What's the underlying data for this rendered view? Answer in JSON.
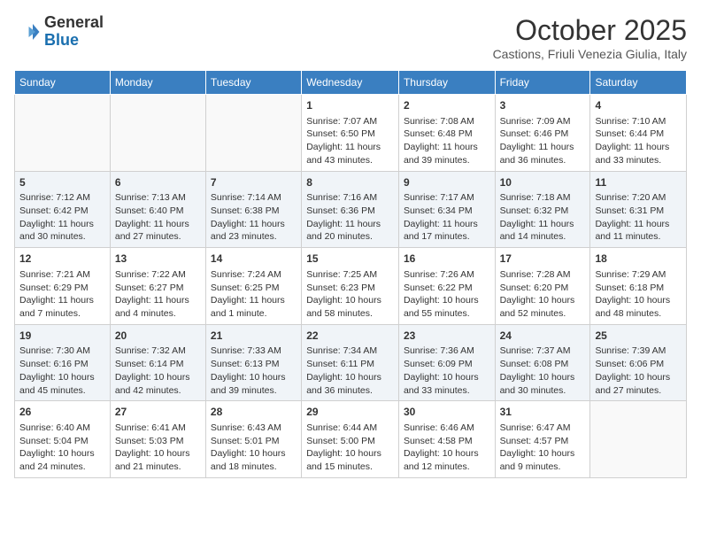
{
  "header": {
    "logo_general": "General",
    "logo_blue": "Blue",
    "month_title": "October 2025",
    "location": "Castions, Friuli Venezia Giulia, Italy"
  },
  "weekdays": [
    "Sunday",
    "Monday",
    "Tuesday",
    "Wednesday",
    "Thursday",
    "Friday",
    "Saturday"
  ],
  "weeks": [
    [
      {
        "day": "",
        "sunrise": "",
        "sunset": "",
        "daylight": ""
      },
      {
        "day": "",
        "sunrise": "",
        "sunset": "",
        "daylight": ""
      },
      {
        "day": "",
        "sunrise": "",
        "sunset": "",
        "daylight": ""
      },
      {
        "day": "1",
        "sunrise": "Sunrise: 7:07 AM",
        "sunset": "Sunset: 6:50 PM",
        "daylight": "Daylight: 11 hours and 43 minutes."
      },
      {
        "day": "2",
        "sunrise": "Sunrise: 7:08 AM",
        "sunset": "Sunset: 6:48 PM",
        "daylight": "Daylight: 11 hours and 39 minutes."
      },
      {
        "day": "3",
        "sunrise": "Sunrise: 7:09 AM",
        "sunset": "Sunset: 6:46 PM",
        "daylight": "Daylight: 11 hours and 36 minutes."
      },
      {
        "day": "4",
        "sunrise": "Sunrise: 7:10 AM",
        "sunset": "Sunset: 6:44 PM",
        "daylight": "Daylight: 11 hours and 33 minutes."
      }
    ],
    [
      {
        "day": "5",
        "sunrise": "Sunrise: 7:12 AM",
        "sunset": "Sunset: 6:42 PM",
        "daylight": "Daylight: 11 hours and 30 minutes."
      },
      {
        "day": "6",
        "sunrise": "Sunrise: 7:13 AM",
        "sunset": "Sunset: 6:40 PM",
        "daylight": "Daylight: 11 hours and 27 minutes."
      },
      {
        "day": "7",
        "sunrise": "Sunrise: 7:14 AM",
        "sunset": "Sunset: 6:38 PM",
        "daylight": "Daylight: 11 hours and 23 minutes."
      },
      {
        "day": "8",
        "sunrise": "Sunrise: 7:16 AM",
        "sunset": "Sunset: 6:36 PM",
        "daylight": "Daylight: 11 hours and 20 minutes."
      },
      {
        "day": "9",
        "sunrise": "Sunrise: 7:17 AM",
        "sunset": "Sunset: 6:34 PM",
        "daylight": "Daylight: 11 hours and 17 minutes."
      },
      {
        "day": "10",
        "sunrise": "Sunrise: 7:18 AM",
        "sunset": "Sunset: 6:32 PM",
        "daylight": "Daylight: 11 hours and 14 minutes."
      },
      {
        "day": "11",
        "sunrise": "Sunrise: 7:20 AM",
        "sunset": "Sunset: 6:31 PM",
        "daylight": "Daylight: 11 hours and 11 minutes."
      }
    ],
    [
      {
        "day": "12",
        "sunrise": "Sunrise: 7:21 AM",
        "sunset": "Sunset: 6:29 PM",
        "daylight": "Daylight: 11 hours and 7 minutes."
      },
      {
        "day": "13",
        "sunrise": "Sunrise: 7:22 AM",
        "sunset": "Sunset: 6:27 PM",
        "daylight": "Daylight: 11 hours and 4 minutes."
      },
      {
        "day": "14",
        "sunrise": "Sunrise: 7:24 AM",
        "sunset": "Sunset: 6:25 PM",
        "daylight": "Daylight: 11 hours and 1 minute."
      },
      {
        "day": "15",
        "sunrise": "Sunrise: 7:25 AM",
        "sunset": "Sunset: 6:23 PM",
        "daylight": "Daylight: 10 hours and 58 minutes."
      },
      {
        "day": "16",
        "sunrise": "Sunrise: 7:26 AM",
        "sunset": "Sunset: 6:22 PM",
        "daylight": "Daylight: 10 hours and 55 minutes."
      },
      {
        "day": "17",
        "sunrise": "Sunrise: 7:28 AM",
        "sunset": "Sunset: 6:20 PM",
        "daylight": "Daylight: 10 hours and 52 minutes."
      },
      {
        "day": "18",
        "sunrise": "Sunrise: 7:29 AM",
        "sunset": "Sunset: 6:18 PM",
        "daylight": "Daylight: 10 hours and 48 minutes."
      }
    ],
    [
      {
        "day": "19",
        "sunrise": "Sunrise: 7:30 AM",
        "sunset": "Sunset: 6:16 PM",
        "daylight": "Daylight: 10 hours and 45 minutes."
      },
      {
        "day": "20",
        "sunrise": "Sunrise: 7:32 AM",
        "sunset": "Sunset: 6:14 PM",
        "daylight": "Daylight: 10 hours and 42 minutes."
      },
      {
        "day": "21",
        "sunrise": "Sunrise: 7:33 AM",
        "sunset": "Sunset: 6:13 PM",
        "daylight": "Daylight: 10 hours and 39 minutes."
      },
      {
        "day": "22",
        "sunrise": "Sunrise: 7:34 AM",
        "sunset": "Sunset: 6:11 PM",
        "daylight": "Daylight: 10 hours and 36 minutes."
      },
      {
        "day": "23",
        "sunrise": "Sunrise: 7:36 AM",
        "sunset": "Sunset: 6:09 PM",
        "daylight": "Daylight: 10 hours and 33 minutes."
      },
      {
        "day": "24",
        "sunrise": "Sunrise: 7:37 AM",
        "sunset": "Sunset: 6:08 PM",
        "daylight": "Daylight: 10 hours and 30 minutes."
      },
      {
        "day": "25",
        "sunrise": "Sunrise: 7:39 AM",
        "sunset": "Sunset: 6:06 PM",
        "daylight": "Daylight: 10 hours and 27 minutes."
      }
    ],
    [
      {
        "day": "26",
        "sunrise": "Sunrise: 6:40 AM",
        "sunset": "Sunset: 5:04 PM",
        "daylight": "Daylight: 10 hours and 24 minutes."
      },
      {
        "day": "27",
        "sunrise": "Sunrise: 6:41 AM",
        "sunset": "Sunset: 5:03 PM",
        "daylight": "Daylight: 10 hours and 21 minutes."
      },
      {
        "day": "28",
        "sunrise": "Sunrise: 6:43 AM",
        "sunset": "Sunset: 5:01 PM",
        "daylight": "Daylight: 10 hours and 18 minutes."
      },
      {
        "day": "29",
        "sunrise": "Sunrise: 6:44 AM",
        "sunset": "Sunset: 5:00 PM",
        "daylight": "Daylight: 10 hours and 15 minutes."
      },
      {
        "day": "30",
        "sunrise": "Sunrise: 6:46 AM",
        "sunset": "Sunset: 4:58 PM",
        "daylight": "Daylight: 10 hours and 12 minutes."
      },
      {
        "day": "31",
        "sunrise": "Sunrise: 6:47 AM",
        "sunset": "Sunset: 4:57 PM",
        "daylight": "Daylight: 10 hours and 9 minutes."
      },
      {
        "day": "",
        "sunrise": "",
        "sunset": "",
        "daylight": ""
      }
    ]
  ]
}
